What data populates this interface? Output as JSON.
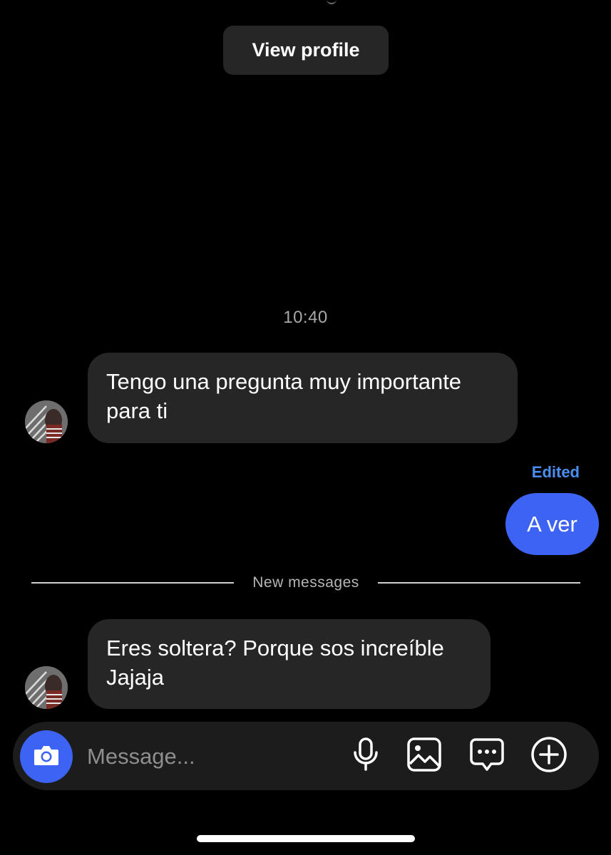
{
  "header": {
    "view_profile_label": "View profile"
  },
  "conversation": {
    "timestamp": "10:40",
    "messages": [
      {
        "direction": "incoming",
        "lines": [
          "Tengo una pregunta muy importante",
          "para ti"
        ]
      },
      {
        "direction": "outgoing",
        "status": "Edited",
        "text": "A ver"
      },
      {
        "direction": "incoming",
        "lines": [
          "Eres soltera? Porque sos increíble",
          "Jajaja"
        ]
      }
    ],
    "divider_label": "New messages"
  },
  "composer": {
    "placeholder": "Message...",
    "icons": [
      "camera-icon",
      "microphone-icon",
      "gallery-icon",
      "sticker-icon",
      "plus-icon"
    ]
  },
  "colors": {
    "background": "#000000",
    "incoming_bubble": "#262626",
    "outgoing_bubble": "#3d63f5",
    "edited_label": "#4a8ff0",
    "composer_bg": "#1c1c1c"
  }
}
